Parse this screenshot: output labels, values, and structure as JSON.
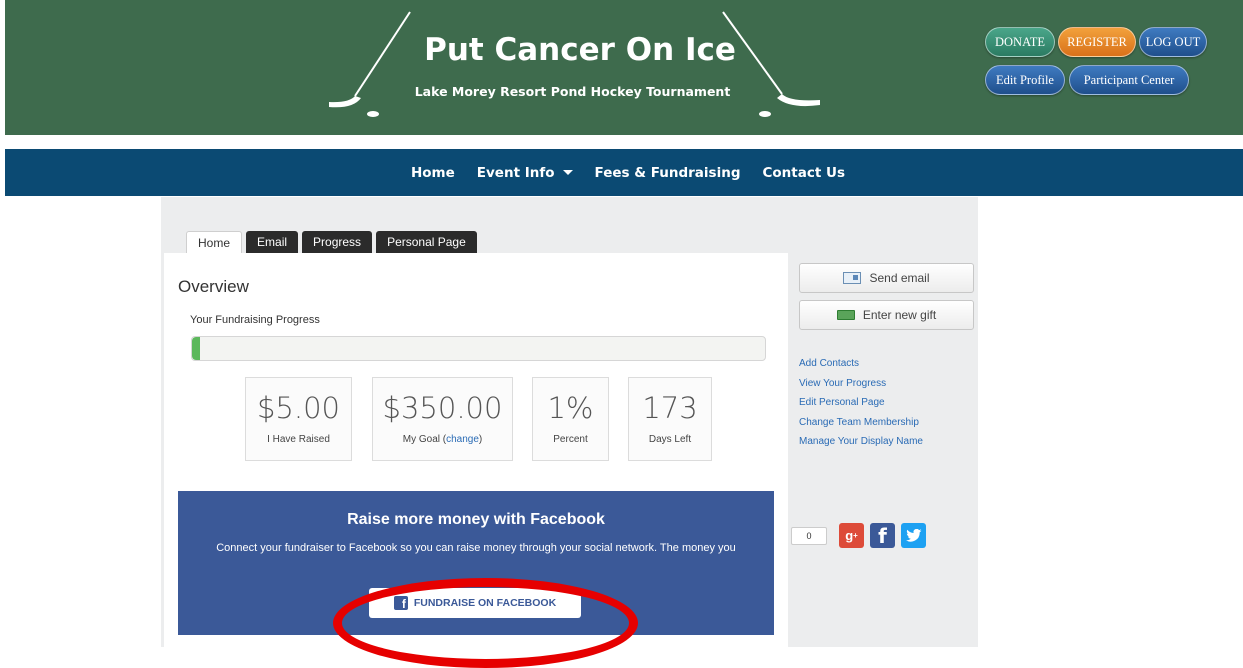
{
  "header": {
    "title": "Put Cancer On Ice",
    "subtitle": "Lake Morey Resort Pond Hockey Tournament",
    "buttons": {
      "donate": "DONATE",
      "register": "REGISTER",
      "logout": "LOG OUT",
      "edit_profile": "Edit Profile",
      "participant_center": "Participant Center"
    }
  },
  "nav": {
    "items": [
      "Home",
      "Event Info",
      "Fees & Fundraising",
      "Contact Us"
    ]
  },
  "tabs": [
    "Home",
    "Email",
    "Progress",
    "Personal Page"
  ],
  "overview": {
    "heading": "Overview",
    "progress_label": "Your Fundraising Progress",
    "progress_fraction": 0.01,
    "stats": {
      "raised": {
        "value": "$5.00",
        "label": "I Have Raised"
      },
      "goal": {
        "value": "$350.00",
        "label": "My Goal",
        "change": "change"
      },
      "percent": {
        "value": "1%",
        "label": "Percent"
      },
      "days": {
        "value": "173",
        "label": "Days Left"
      }
    }
  },
  "facebook": {
    "title": "Raise more money with Facebook",
    "text": "Connect your fundraiser to Facebook so you can raise money through your social network. The money you",
    "button": "FUNDRAISE ON FACEBOOK"
  },
  "sidebar": {
    "send_email": "Send email",
    "enter_gift": "Enter new gift",
    "links": [
      "Add Contacts",
      "View Your Progress",
      "Edit Personal Page",
      "Change Team Membership",
      "Manage Your Display Name"
    ],
    "share_count": "0"
  },
  "colors": {
    "banner": "#3e6b4d",
    "nav": "#0b4a73",
    "facebook": "#3b5998",
    "highlight": "#e60000"
  }
}
